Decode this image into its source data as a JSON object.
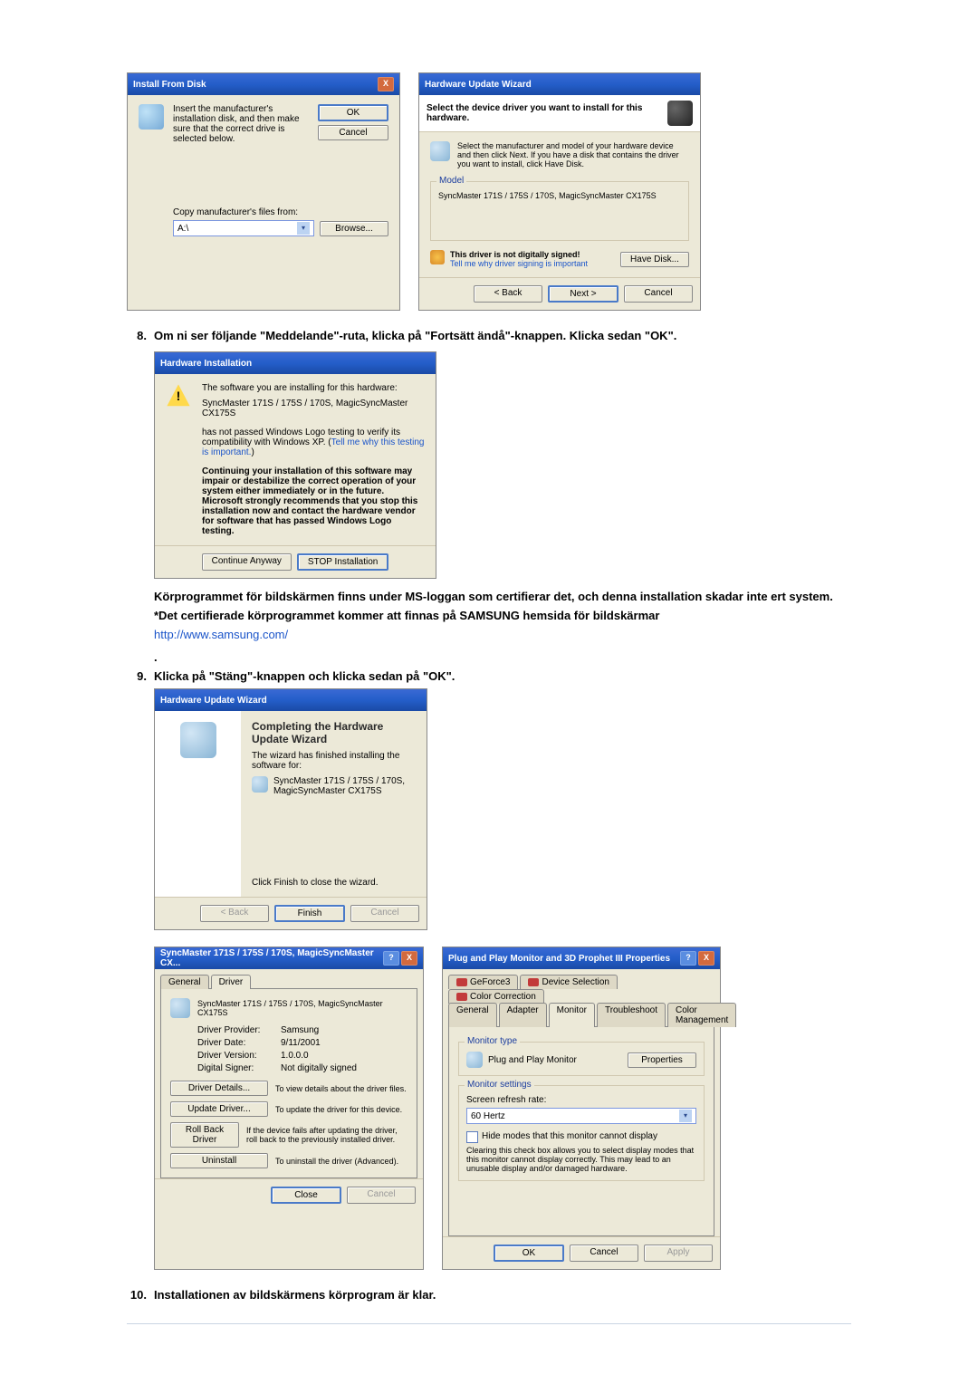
{
  "install_from_disk": {
    "title": "Install From Disk",
    "instruction": "Insert the manufacturer's installation disk, and then make sure that the correct drive is selected below.",
    "ok": "OK",
    "cancel": "Cancel",
    "copy_label": "Copy manufacturer's files from:",
    "path_value": "A:\\",
    "browse": "Browse..."
  },
  "hw_update_top": {
    "title": "Hardware Update Wizard",
    "headline": "Select the device driver you want to install for this hardware.",
    "body": "Select the manufacturer and model of your hardware device and then click Next. If you have a disk that contains the driver you want to install, click Have Disk.",
    "model_label": "Model",
    "model_value": "SyncMaster 171S / 175S / 170S, MagicSyncMaster CX175S",
    "warn": "This driver is not digitally signed!",
    "tell": "Tell me why driver signing is important",
    "have_disk": "Have Disk...",
    "back": "< Back",
    "next": "Next >",
    "cancel": "Cancel"
  },
  "step8": {
    "num": "8.",
    "text": "Om ni ser följande \"Meddelande\"-ruta, klicka på \"Fortsätt ändå\"-knappen. Klicka sedan \"OK\"."
  },
  "hw_install": {
    "title": "Hardware Installation",
    "line1": "The software you are installing for this hardware:",
    "line2": "SyncMaster 171S / 175S / 170S, MagicSyncMaster CX175S",
    "line3": "has not passed Windows Logo testing to verify its compatibility with Windows XP. (",
    "tell": "Tell me why this testing is important.",
    "line3b": ")",
    "bold": "Continuing your installation of this software may impair or destabilize the correct operation of your system either immediately or in the future. Microsoft strongly recommends that you stop this installation now and contact the hardware vendor for software that has passed Windows Logo testing.",
    "cont": "Continue Anyway",
    "stop": "STOP Installation"
  },
  "after8": {
    "p1": "Körprogrammet för bildskärmen finns under MS-loggan som certifierar det, och denna installation skadar inte ert system.",
    "p2a": "*Det certifierade körprogrammet kommer att finnas på SAMSUNG hemsida för bildskärmar",
    "link": "http://www.samsung.com/",
    "dot": "."
  },
  "step9": {
    "num": "9.",
    "text": "Klicka på \"Stäng\"-knappen och klicka sedan på \"OK\"."
  },
  "hw_complete": {
    "title": "Hardware Update Wizard",
    "h1": "Completing the Hardware Update Wizard",
    "line1": "The wizard has finished installing the software for:",
    "device": "SyncMaster 171S / 175S / 170S, MagicSyncMaster CX175S",
    "line2": "Click Finish to close the wizard.",
    "back": "< Back",
    "finish": "Finish",
    "cancel": "Cancel"
  },
  "props_driver": {
    "title": "SyncMaster 171S / 175S / 170S, MagicSyncMaster CX... ",
    "tab_general": "General",
    "tab_driver": "Driver",
    "device": "SyncMaster 171S / 175S / 170S, MagicSyncMaster CX175S",
    "dp_l": "Driver Provider:",
    "dp_v": "Samsung",
    "dd_l": "Driver Date:",
    "dd_v": "9/11/2001",
    "dv_l": "Driver Version:",
    "dv_v": "1.0.0.0",
    "ds_l": "Digital Signer:",
    "ds_v": "Not digitally signed",
    "b_details": "Driver Details...",
    "b_details_d": "To view details about the driver files.",
    "b_update": "Update Driver...",
    "b_update_d": "To update the driver for this device.",
    "b_roll": "Roll Back Driver",
    "b_roll_d": "If the device fails after updating the driver, roll back to the previously installed driver.",
    "b_uninst": "Uninstall",
    "b_uninst_d": "To uninstall the driver (Advanced).",
    "close": "Close",
    "cancel": "Cancel"
  },
  "props_monitor": {
    "title": "Plug and Play Monitor and 3D Prophet III Properties",
    "tabs_top": [
      "GeForce3",
      "Device Selection",
      "Color Correction"
    ],
    "tabs_bottom": [
      "General",
      "Adapter",
      "Monitor",
      "Troubleshoot",
      "Color Management"
    ],
    "mt_label": "Monitor type",
    "mt_value": "Plug and Play Monitor",
    "mt_btn": "Properties",
    "ms_label": "Monitor settings",
    "refresh_l": "Screen refresh rate:",
    "refresh_v": "60 Hertz",
    "hide_chk": "Hide modes that this monitor cannot display",
    "hide_txt": "Clearing this check box allows you to select display modes that this monitor cannot display correctly. This may lead to an unusable display and/or damaged hardware.",
    "ok": "OK",
    "cancel": "Cancel",
    "apply": "Apply"
  },
  "step10": {
    "num": "10.",
    "text": "Installationen av bildskärmens körprogram är klar."
  }
}
